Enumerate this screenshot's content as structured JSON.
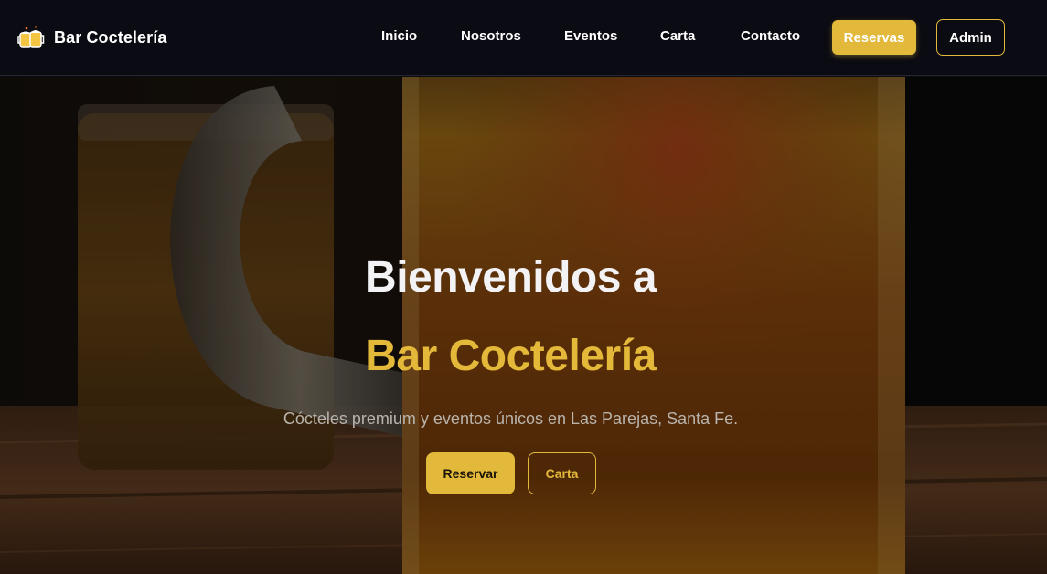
{
  "brand": {
    "name": "Bar Coctelería",
    "icon": "beer-mugs-icon"
  },
  "nav": {
    "links": [
      "Inicio",
      "Nosotros",
      "Eventos",
      "Carta",
      "Contacto"
    ],
    "reservas_label": "Reservas",
    "admin_label": "Admin"
  },
  "hero": {
    "title_line1": "Bienvenidos a",
    "title_line2": "Bar Coctelería",
    "subtitle": "Cócteles premium y eventos únicos en Las Parejas, Santa Fe.",
    "primary_button": "Reservar",
    "secondary_button": "Carta",
    "background": "beer-mug-photo"
  },
  "colors": {
    "accent": "#e2b93b",
    "navbar_bg": "#0b0b13",
    "text_light": "#ffffff",
    "subtitle": "#b9b4ad"
  }
}
